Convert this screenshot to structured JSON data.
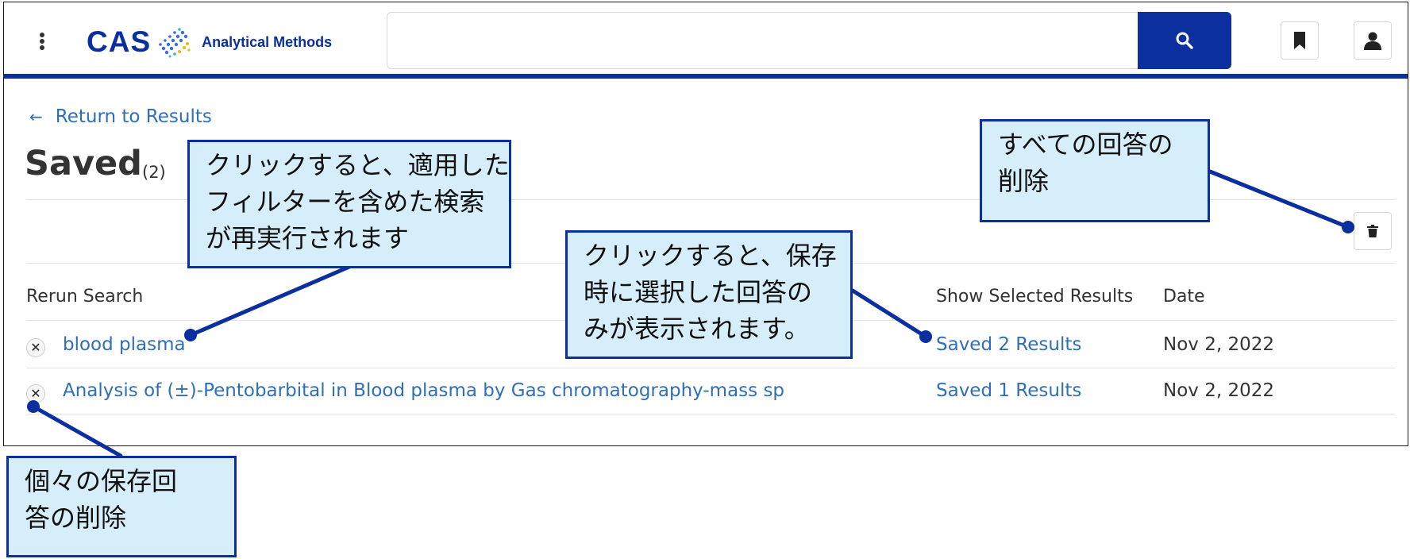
{
  "header": {
    "logo_text": "CAS",
    "logo_subtitle": "Analytical Methods",
    "search_value": "",
    "search_placeholder": ""
  },
  "nav": {
    "return_label": "Return to Results"
  },
  "page": {
    "title": "Saved",
    "count": "(2)"
  },
  "table": {
    "headers": {
      "rerun": "Rerun Search",
      "selected": "Show Selected Results",
      "date": "Date"
    },
    "rows": [
      {
        "search": "blood plasma",
        "results": "Saved 2 Results",
        "date": "Nov 2, 2022"
      },
      {
        "search": "Analysis of (±)-Pentobarbital in Blood plasma by Gas chromatography-mass sp",
        "results": "Saved 1 Results",
        "date": "Nov 2, 2022"
      }
    ]
  },
  "callouts": {
    "rerun": [
      "クリックすると、適用した",
      "フィルターを含めた検索",
      "が再実行されます"
    ],
    "selected": [
      "クリックすると、保存",
      "時に選択した回答の",
      "みが表示されます。"
    ],
    "delete_all": [
      "すべての回答の",
      "削除"
    ],
    "delete_one": [
      "個々の保存回",
      "答の削除"
    ]
  },
  "colors": {
    "brand": "#0b2f9f",
    "link": "#2f6fba",
    "callout_fill": "#d6eef9"
  },
  "icons": {
    "menu": "kebab-menu-icon",
    "logo": "cas-logo-mark-icon",
    "search": "search-icon",
    "bookmark": "bookmark-icon",
    "user": "user-icon",
    "back": "arrow-left-icon",
    "delete_all": "trash-icon",
    "remove": "close-icon"
  }
}
